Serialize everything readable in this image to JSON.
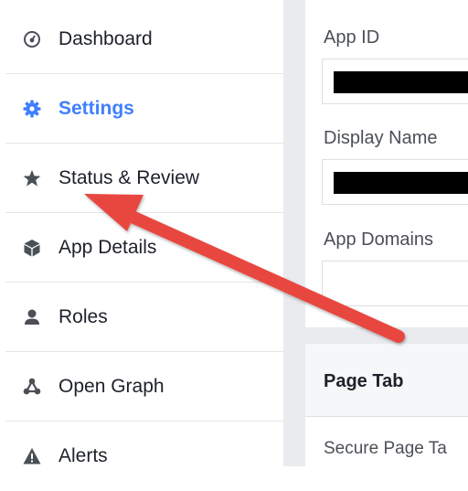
{
  "sidebar": {
    "items": [
      {
        "label": "Dashboard",
        "icon": "dashboard-icon"
      },
      {
        "label": "Settings",
        "icon": "gear-icon",
        "active": true
      },
      {
        "label": "Status & Review",
        "icon": "star-icon"
      },
      {
        "label": "App Details",
        "icon": "cube-icon"
      },
      {
        "label": "Roles",
        "icon": "person-icon"
      },
      {
        "label": "Open Graph",
        "icon": "graph-nodes-icon"
      },
      {
        "label": "Alerts",
        "icon": "warning-icon"
      }
    ]
  },
  "settings": {
    "app_id_label": "App ID",
    "display_name_label": "Display Name",
    "app_domains_label": "App Domains",
    "page_tab_title": "Page Tab",
    "secure_page_tab_label": "Secure Page Ta"
  },
  "colors": {
    "active_nav": "#4080ff",
    "annotation_arrow": "#e8473f",
    "gutter": "#e9ebee"
  }
}
